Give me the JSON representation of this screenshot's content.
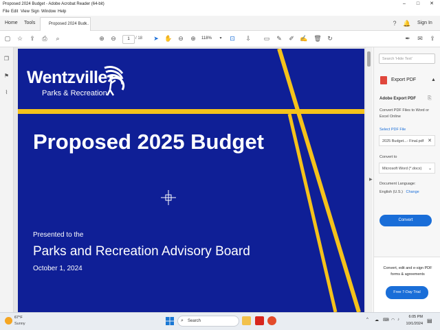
{
  "window": {
    "title": "Proposed 2024 Budget - Adobe Acrobat Reader (64-bit)",
    "controls": [
      "–",
      "□",
      "✕"
    ]
  },
  "menu": [
    "File",
    "Edit",
    "View",
    "Sign",
    "Window",
    "Help"
  ],
  "tabs": {
    "home": "Home",
    "tools": "Tools",
    "document": "Proposed 2024 Bud...",
    "sign_in": "Sign In"
  },
  "toolbar": {
    "current_page": "1",
    "total_pages": "/ 18",
    "zoom": "118%"
  },
  "slide": {
    "logo_word": "Wentzville",
    "logo_sub": "Parks & Recreation",
    "title": "Proposed 2025 Budget",
    "presented_to": "Presented to the",
    "board": "Parks and Recreation Advisory Board",
    "date": "October 1, 2024",
    "colors": {
      "background": "#0f1f96",
      "accent": "#f5c21b"
    }
  },
  "right_panel": {
    "search_placeholder": "Search 'Hide Text'",
    "export_header": "Export PDF",
    "adobe_export_title": "Adobe Export PDF",
    "description": "Convert PDF Files to Word or Excel Online",
    "select_file_label": "Select PDF File",
    "file_name": "2025 Budget...- Final.pdf",
    "convert_to_label": "Convert to",
    "format": "Microsoft Word (*.docx)",
    "doc_language_label": "Document Language:",
    "language": "English (U.S.)",
    "change_link": "Change",
    "convert_button": "Convert",
    "promo_text": "Convert, edit and e-sign PDF forms & agreements",
    "trial_button": "Free 7-Day Trial"
  },
  "taskbar": {
    "temperature": "67°F",
    "weather": "Sunny",
    "search": "Search",
    "time": "6:05 PM",
    "date": "10/1/2024"
  }
}
